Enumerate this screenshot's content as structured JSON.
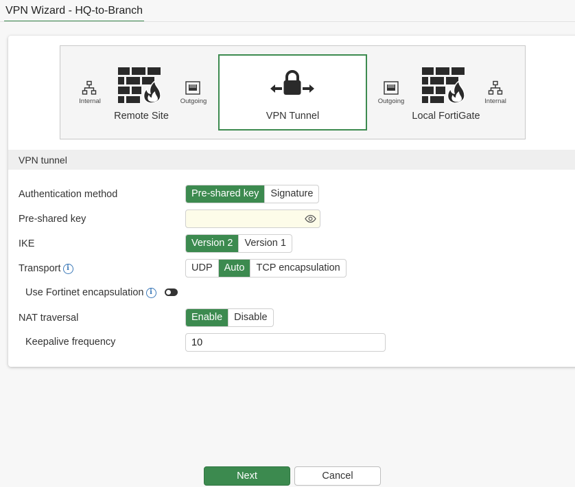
{
  "header": {
    "title": "VPN Wizard - HQ-to-Branch"
  },
  "diagram": {
    "remote_site": "Remote Site",
    "vpn_tunnel": "VPN Tunnel",
    "local_fortigate": "Local FortiGate",
    "internal_label": "Internal",
    "outgoing_label": "Outgoing"
  },
  "section": {
    "title": "VPN tunnel"
  },
  "form": {
    "auth_method": {
      "label": "Authentication method",
      "options": [
        "Pre-shared key",
        "Signature"
      ],
      "selected": "Pre-shared key"
    },
    "psk": {
      "label": "Pre-shared key",
      "value": ""
    },
    "ike": {
      "label": "IKE",
      "options": [
        "Version 2",
        "Version 1"
      ],
      "selected": "Version 2"
    },
    "transport": {
      "label": "Transport",
      "options": [
        "UDP",
        "Auto",
        "TCP encapsulation"
      ],
      "selected": "Auto"
    },
    "fortinet_encap": {
      "label": "Use Fortinet encapsulation",
      "enabled": false
    },
    "nat": {
      "label": "NAT traversal",
      "options": [
        "Enable",
        "Disable"
      ],
      "selected": "Enable"
    },
    "keepalive": {
      "label": "Keepalive frequency",
      "value": "10"
    }
  },
  "footer": {
    "next": "Next",
    "cancel": "Cancel"
  }
}
